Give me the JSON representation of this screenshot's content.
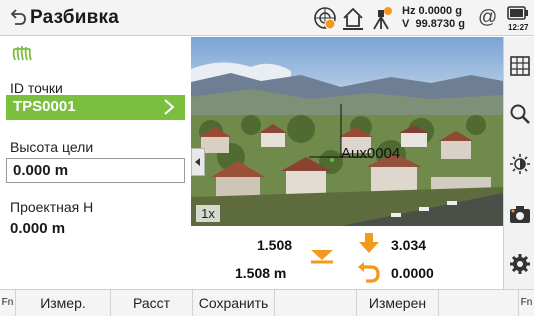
{
  "header": {
    "title": "Разбивка",
    "hz_label": "Hz",
    "hz_value": "0.0000 g",
    "v_label": "V",
    "v_value": "99.8730 g",
    "time": "12:27",
    "target_mode_symbol": "@"
  },
  "left_panel": {
    "point_id_label": "ID точки",
    "point_id_value": "TPS0001",
    "target_height_label": "Высота цели",
    "target_height_value": "0.000 m",
    "design_height_label": "Проектная H",
    "design_height_value": "0.000 m"
  },
  "camera": {
    "zoom": "1x",
    "target_label": "Aux0004"
  },
  "deltas": {
    "top_left_value": "1.508",
    "bottom_left_value": "1.508 m",
    "top_right_value": "3.034",
    "bottom_right_value": "0.0000"
  },
  "softkeys": [
    {
      "label": "Fn"
    },
    {
      "label": "Измер."
    },
    {
      "label": "Расст"
    },
    {
      "label": "Сохранить"
    },
    {
      "label": ""
    },
    {
      "label": "Измерен"
    },
    {
      "label": "Fn"
    }
  ],
  "icons": {
    "back": "back-arrow-icon",
    "level": "level-bubble-icon",
    "home": "home-icon",
    "station": "station-setup-icon",
    "battery": "battery-icon",
    "prism": "prism-icon",
    "grid": "grid-icon",
    "search": "magnifier-icon",
    "brightness": "brightness-icon",
    "camera": "camera-icon",
    "settings": "gear-icon"
  },
  "colors": {
    "accent_green": "#7bbf3f",
    "arrow_orange": "#f39a1e",
    "marker_green": "#5cc33a"
  }
}
